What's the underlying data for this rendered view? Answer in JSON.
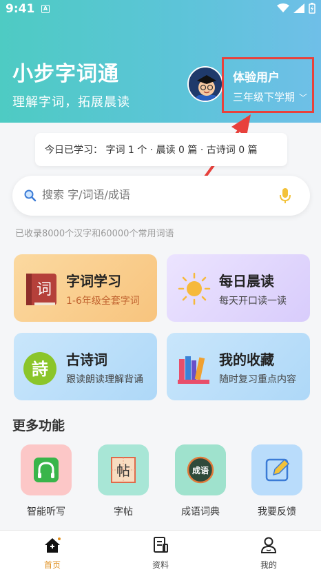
{
  "status": {
    "time": "9:41",
    "sim_label": "A"
  },
  "header": {
    "title": "小步字词通",
    "subtitle": "理解字词，拓展晨读",
    "user_name": "体验用户",
    "grade": "三年级下学期"
  },
  "today": {
    "text": "今日已学习：  字词 1 个 · 晨读 0 篇 · 古诗词 0 篇"
  },
  "search": {
    "placeholder": "搜索 字/词语/成语"
  },
  "record": "已收录8000个汉字和60000个常用词语",
  "cards": [
    {
      "title": "字词学习",
      "sub": "1-6年级全套字词",
      "icon_char": "词"
    },
    {
      "title": "每日晨读",
      "sub": "每天开口读一读"
    },
    {
      "title": "古诗词",
      "sub": "跟读朗读理解背诵",
      "icon_char": "詩"
    },
    {
      "title": "我的收藏",
      "sub": "随时复习重点内容"
    }
  ],
  "more": {
    "title": "更多功能",
    "items": [
      {
        "label": "智能听写"
      },
      {
        "label": "字帖",
        "icon_char": "帖"
      },
      {
        "label": "成语词典",
        "icon_char": "成语"
      },
      {
        "label": "我要反馈"
      }
    ]
  },
  "tabs": [
    {
      "label": "首页"
    },
    {
      "label": "资料"
    },
    {
      "label": "我的"
    }
  ],
  "colors": {
    "accent": "#e09020",
    "highlight": "#e8413c",
    "header_start": "#4ecbc3",
    "header_end": "#6fbfe8"
  }
}
